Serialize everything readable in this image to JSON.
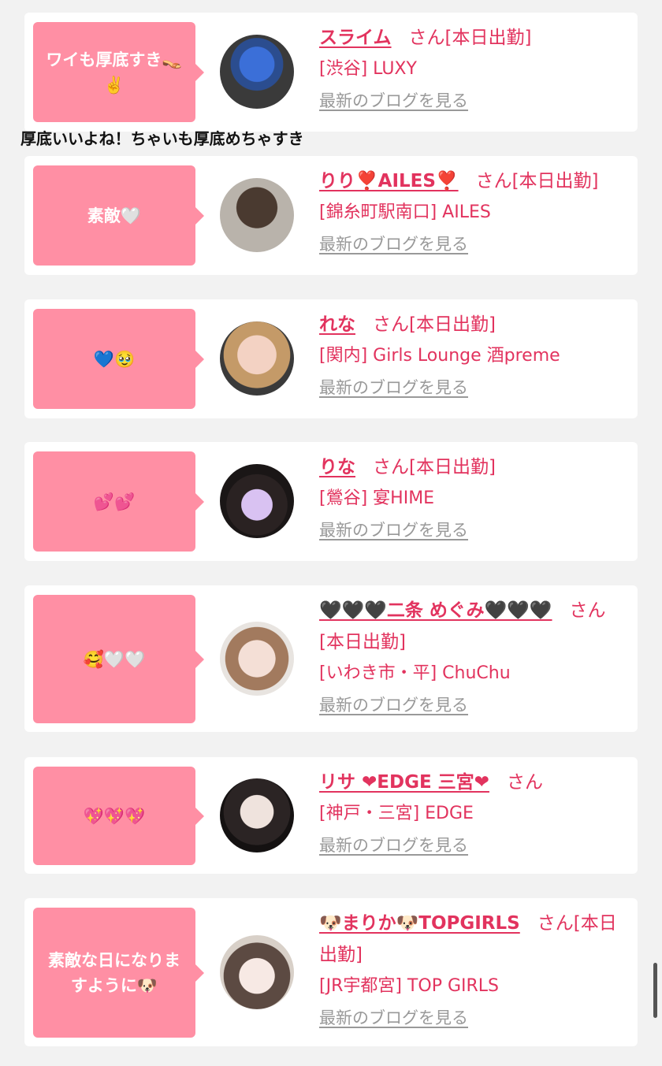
{
  "blog_link_label": "最新のブログを見る",
  "comment": "厚底いいよね！ちゃいも厚底めちゃすき",
  "entries": [
    {
      "message": "ワイも厚底すき👡✌️",
      "name": "スライム",
      "suffix": "さん[本日出勤]",
      "shop": "[渋谷] LUXY"
    },
    {
      "message": "素敵🤍",
      "name": "りり❣️AILES❣️",
      "suffix": "さん[本日出勤]",
      "shop": "[錦糸町駅南口] AILES"
    },
    {
      "message": "💙🥹",
      "name": "れな",
      "suffix": "さん[本日出勤]",
      "shop": "[関内] Girls Lounge 酒preme"
    },
    {
      "message": "💕💕",
      "name": "りな",
      "suffix": "さん[本日出勤]",
      "shop": "[鶯谷] 宴HIME"
    },
    {
      "message": "🥰🤍🤍",
      "name": "🖤🖤🖤二条 めぐみ🖤🖤🖤",
      "suffix": "さん[本日出勤]",
      "shop": "[いわき市・平] ChuChu"
    },
    {
      "message": "💖💖💖",
      "name": "リサ ❤EDGE 三宮❤",
      "suffix": "さん",
      "shop": "[神戸・三宮] EDGE"
    },
    {
      "message": "素敵な日になりますように🐶",
      "name": "🐶まりか🐶TOPGIRLS",
      "suffix": "さん[本日出勤]",
      "shop": "[JR宇都宮] TOP GIRLS"
    }
  ]
}
